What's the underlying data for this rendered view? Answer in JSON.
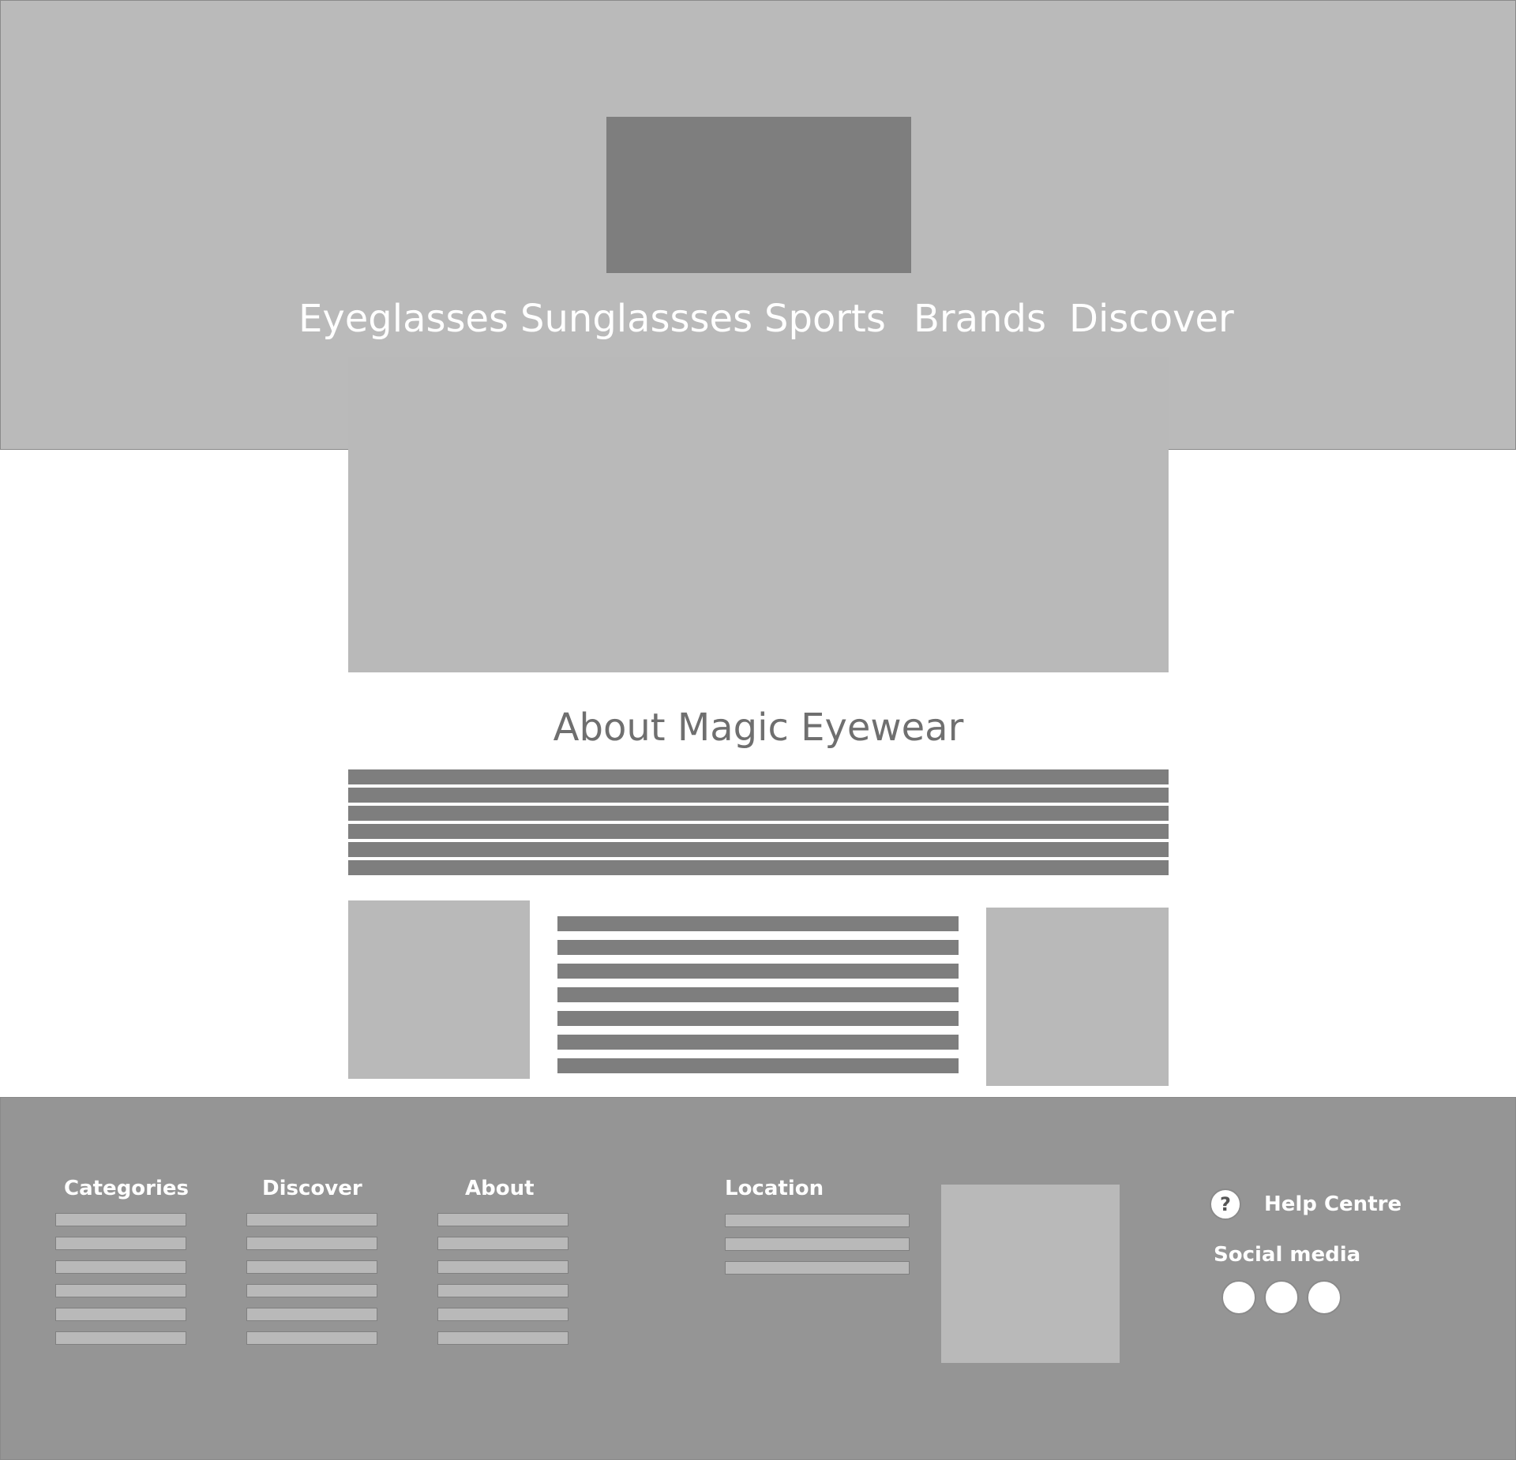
{
  "nav": {
    "items": [
      {
        "label": "Eyeglasses"
      },
      {
        "label": "Sunglassses"
      },
      {
        "label": "Sports"
      },
      {
        "label": "Brands"
      },
      {
        "label": "Discover"
      }
    ]
  },
  "about": {
    "title": "About Magic Eyewear"
  },
  "footer": {
    "categories_heading": "Categories",
    "discover_heading": "Discover",
    "about_heading": "About",
    "location_heading": "Location",
    "help_icon": "?",
    "help_label": "Help Centre",
    "social_heading": "Social media"
  },
  "colors": {
    "header_bg": "#bababa",
    "footer_bg": "#959595",
    "placeholder_dark": "#7e7e7e",
    "placeholder_light": "#b9b9b9",
    "title_text": "#6f6f6f"
  }
}
